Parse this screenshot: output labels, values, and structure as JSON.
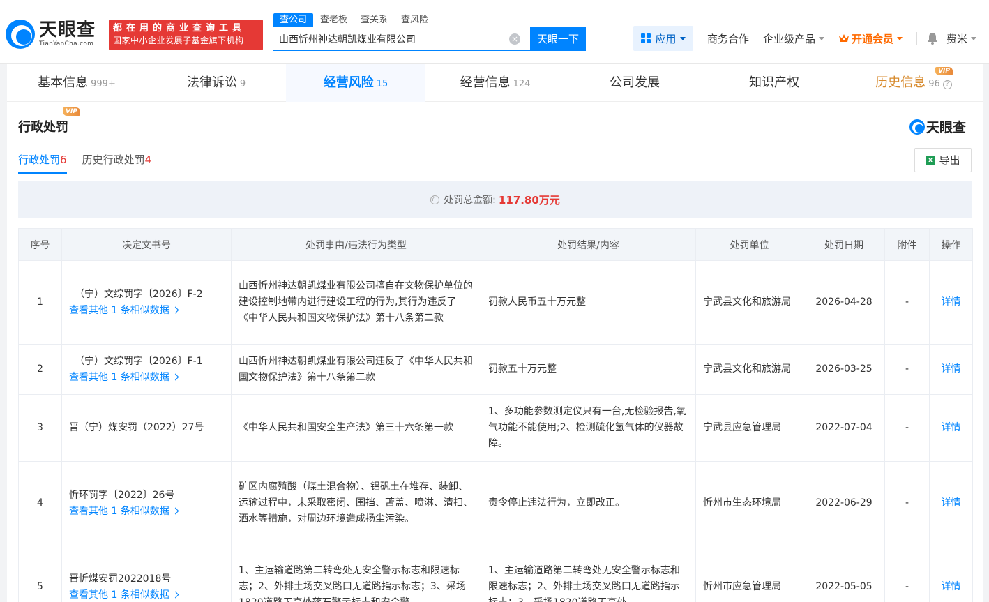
{
  "header": {
    "logo_cn": "天眼查",
    "logo_en": "TianYanCha.com",
    "slogan_line1": "都在用的商业查询工具",
    "slogan_line2": "国家中小企业发展子基金旗下机构",
    "search_tabs": [
      "查公司",
      "查老板",
      "查关系",
      "查风险"
    ],
    "search_value": "山西忻州神达朝凯煤业有限公司",
    "search_button": "天眼一下",
    "apps_label": "应用",
    "nav": [
      "商务合作",
      "企业级产品"
    ],
    "vip_label": "开通会员",
    "user_name": "费米"
  },
  "main_tabs": [
    {
      "label": "基本信息",
      "count": "999+"
    },
    {
      "label": "法律诉讼",
      "count": "9"
    },
    {
      "label": "经营风险",
      "count": "15"
    },
    {
      "label": "经营信息",
      "count": "124"
    },
    {
      "label": "公司发展",
      "count": ""
    },
    {
      "label": "知识产权",
      "count": ""
    },
    {
      "label": "历史信息",
      "count": "96"
    }
  ],
  "vip_text": "VIP",
  "section": {
    "title": "行政处罚",
    "watermark": "天眼查",
    "sub_tabs": [
      {
        "label": "行政处罚",
        "count": "6"
      },
      {
        "label": "历史行政处罚",
        "count": "4"
      }
    ],
    "export_label": "导出",
    "summary_label": "处罚总金额:",
    "summary_amount": "117.80万元"
  },
  "table": {
    "headers": [
      "序号",
      "决定文书号",
      "处罚事由/违法行为类型",
      "处罚结果/内容",
      "处罚单位",
      "处罚日期",
      "附件",
      "操作"
    ],
    "similar_text": "查看其他 1 条相似数据",
    "detail_text": "详情",
    "rows": [
      {
        "idx": "1",
        "doc": "（宁）文综罚字〔2026〕F-2",
        "reason": "山西忻州神达朝凯煤业有限公司擅自在文物保护单位的建设控制地带内进行建设工程的行为,其行为违反了《中华人民共和国文物保护法》第十八条第二款",
        "result": "罚款人民币五十万元整",
        "unit": "宁武县文化和旅游局",
        "date": "2026-04-28",
        "att": "-"
      },
      {
        "idx": "2",
        "doc": "（宁）文综罚字〔2026〕F-1",
        "reason": "山西忻州神达朝凯煤业有限公司违反了《中华人民共和国文物保护法》第十八条第二款",
        "result": "罚款五十万元整",
        "unit": "宁武县文化和旅游局",
        "date": "2026-03-25",
        "att": "-"
      },
      {
        "idx": "3",
        "doc": "晋（宁）煤安罚（2022）27号",
        "reason": "《中华人民共和国安全生产法》第三十六条第一款",
        "result": "1、多功能参数测定仪只有一台,无检验报告,氧气功能不能使用;2、检测硫化氢气体的仪器故障。",
        "unit": "宁武县应急管理局",
        "date": "2022-07-04",
        "att": "-"
      },
      {
        "idx": "4",
        "doc": "忻环罚字〔2022〕26号",
        "reason": "矿区内腐殖酸（煤土混合物）、铝矾土在堆存、装卸、运输过程中，未采取密闭、围挡、苫盖、喷淋、清扫、洒水等措施，对周边环境造成扬尘污染。",
        "result": "责令停止违法行为，立即改正。",
        "unit": "忻州市生态环境局",
        "date": "2022-06-29",
        "att": "-"
      },
      {
        "idx": "5",
        "doc": "晋忻煤安罚2022018号",
        "reason": "1、主运输道路第二转弯处无安全警示标志和限速标志；2、外排土场交叉路口无道路指示标志；3、采场1820道路无高处落石警示标志和安全警",
        "result": "1、主运输道路第二转弯处无安全警示标志和限速标志；2、外排土场交叉路口无道路指示标志；3、采场1820道路无高处",
        "unit": "忻州市应急管理局",
        "date": "2022-05-05",
        "att": "-"
      }
    ]
  },
  "colors": {
    "accent": "#0084ff",
    "danger": "#e53935",
    "vip": "#ff6a00"
  }
}
